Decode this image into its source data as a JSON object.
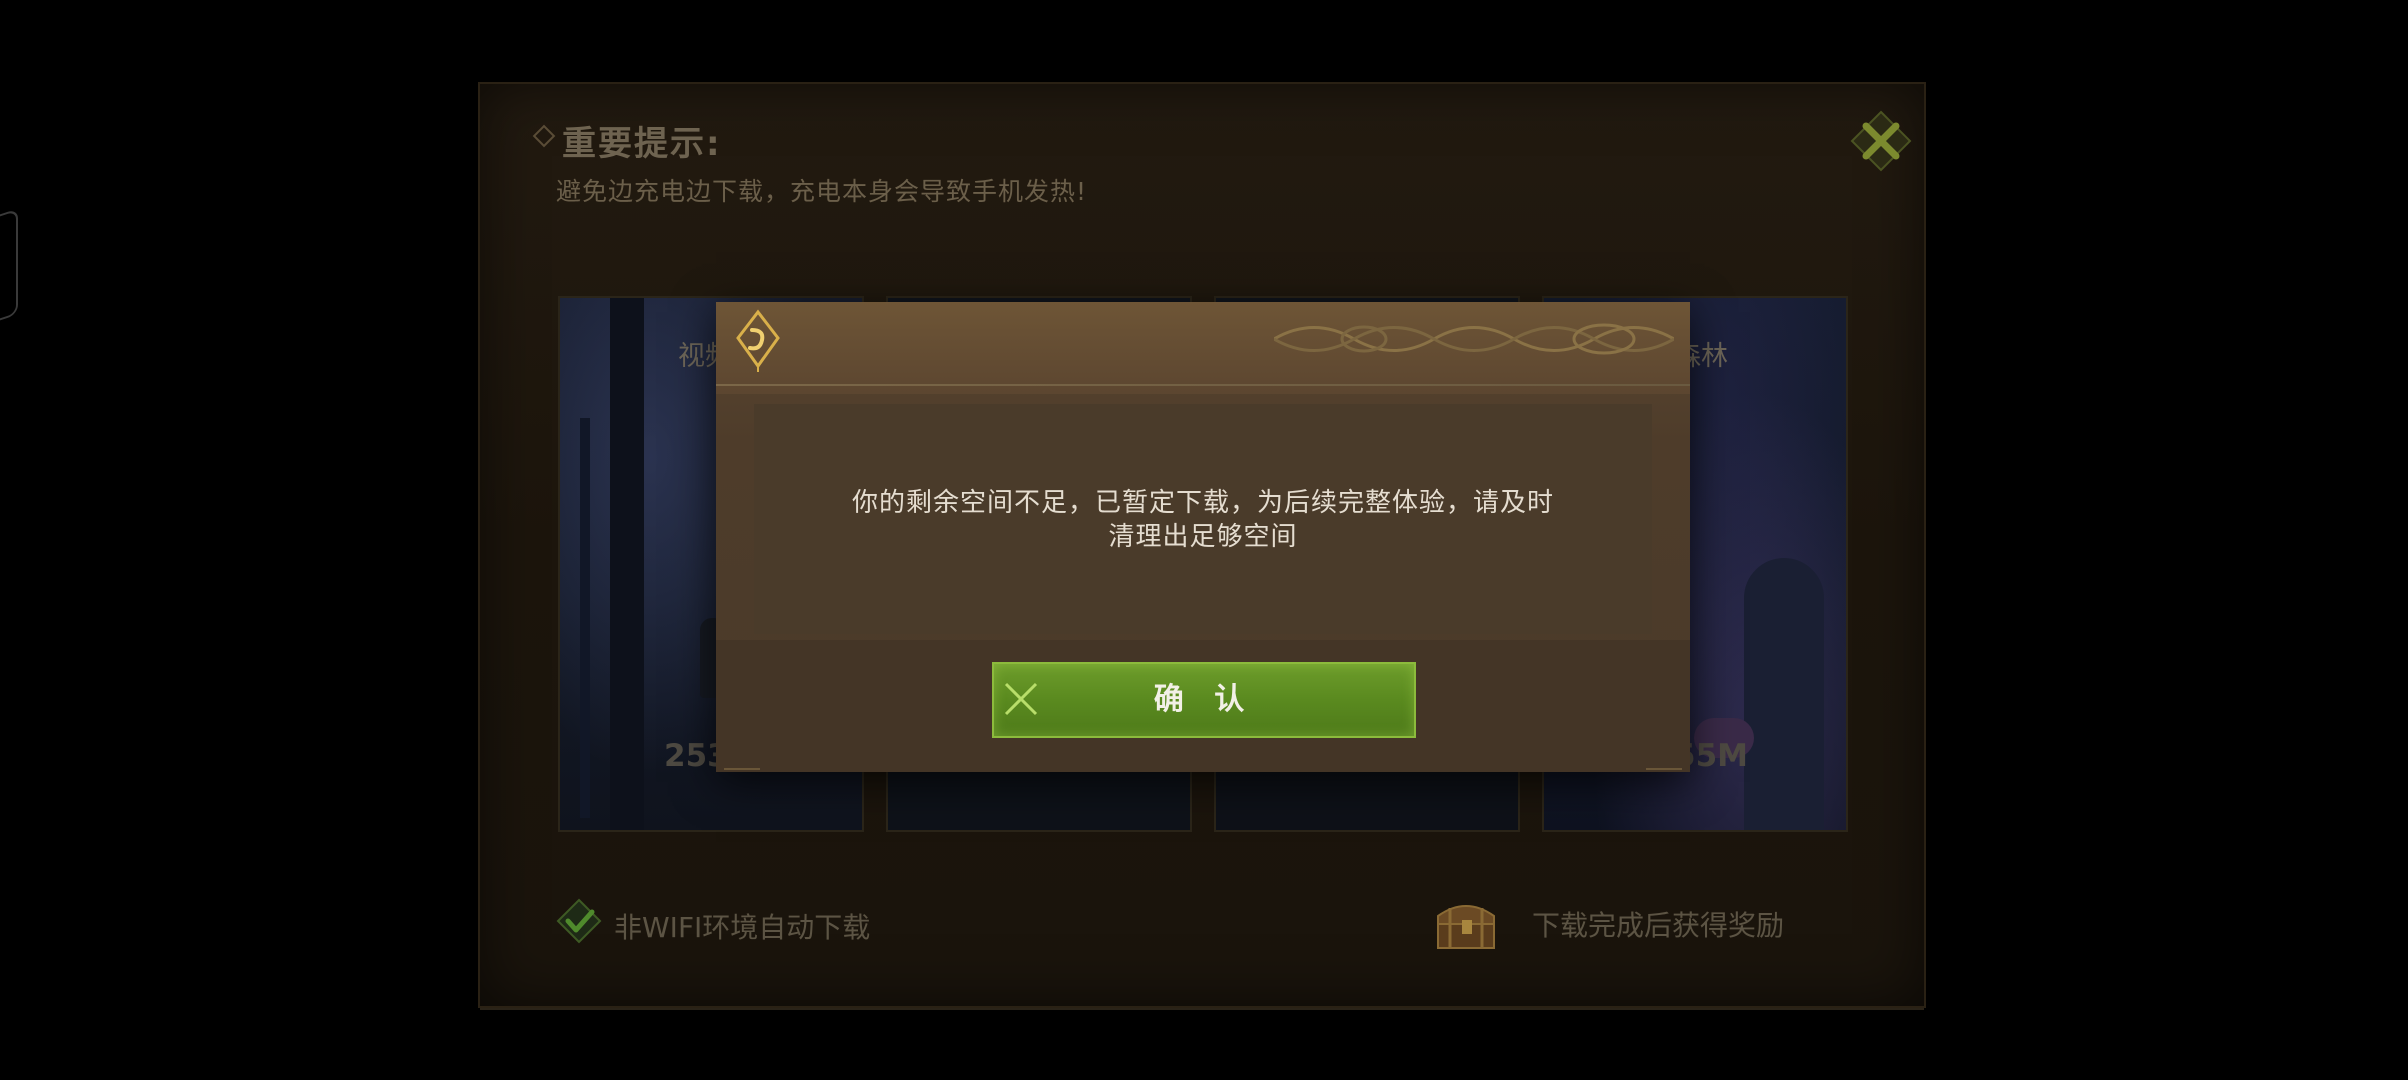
{
  "background_panel": {
    "title": "重要提示:",
    "subtitle": "避免边充电边下载，充电本身会导致手机发热!",
    "cards": [
      {
        "label": "视频",
        "size": "253"
      },
      {
        "label": "",
        "size": ""
      },
      {
        "label": "",
        "size": ""
      },
      {
        "label": "森林",
        "size": "55M"
      }
    ],
    "auto_download_label": "非WIFI环境自动下载",
    "auto_download_checked": true,
    "reward_label": "下载完成后获得奖励"
  },
  "dialog": {
    "message_line1": "你的剩余空间不足，已暂定下载，为后续完整体验，请及时",
    "message_line2": "清理出足够空间",
    "confirm_label": "确 认"
  },
  "colors": {
    "confirm_green": "#5a8a1f",
    "dialog_brown": "#4e3c2a",
    "gold_accent": "#d9b04a"
  }
}
